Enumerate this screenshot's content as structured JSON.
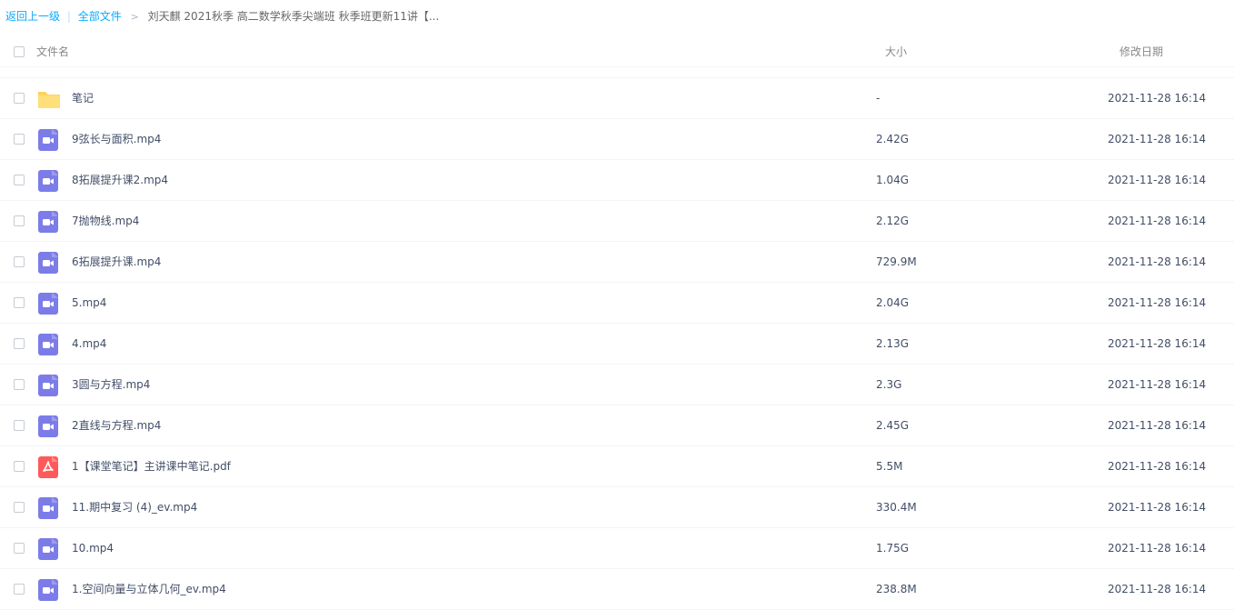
{
  "breadcrumb": {
    "back": "返回上一级",
    "separator": "|",
    "all_files": "全部文件",
    "arrow": ">",
    "current": "刘天麒 2021秋季 高二数学秋季尖端班 秋季班更新11讲【..."
  },
  "table": {
    "headers": {
      "name": "文件名",
      "size": "大小",
      "date": "修改日期"
    },
    "rows": [
      {
        "type": "folder",
        "icon": "folder-icon",
        "name": "笔记",
        "size": "-",
        "date": "2021-11-28 16:14"
      },
      {
        "type": "video",
        "icon": "video-file-icon",
        "name": "9弦长与面积.mp4",
        "size": "2.42G",
        "date": "2021-11-28 16:14"
      },
      {
        "type": "video",
        "icon": "video-file-icon",
        "name": "8拓展提升课2.mp4",
        "size": "1.04G",
        "date": "2021-11-28 16:14"
      },
      {
        "type": "video",
        "icon": "video-file-icon",
        "name": "7抛物线.mp4",
        "size": "2.12G",
        "date": "2021-11-28 16:14"
      },
      {
        "type": "video",
        "icon": "video-file-icon",
        "name": "6拓展提升课.mp4",
        "size": "729.9M",
        "date": "2021-11-28 16:14"
      },
      {
        "type": "video",
        "icon": "video-file-icon",
        "name": "5.mp4",
        "size": "2.04G",
        "date": "2021-11-28 16:14"
      },
      {
        "type": "video",
        "icon": "video-file-icon",
        "name": "4.mp4",
        "size": "2.13G",
        "date": "2021-11-28 16:14"
      },
      {
        "type": "video",
        "icon": "video-file-icon",
        "name": "3圆与方程.mp4",
        "size": "2.3G",
        "date": "2021-11-28 16:14"
      },
      {
        "type": "video",
        "icon": "video-file-icon",
        "name": "2直线与方程.mp4",
        "size": "2.45G",
        "date": "2021-11-28 16:14"
      },
      {
        "type": "pdf",
        "icon": "pdf-file-icon",
        "name": "1【课堂笔记】主讲课中笔记.pdf",
        "size": "5.5M",
        "date": "2021-11-28 16:14"
      },
      {
        "type": "video",
        "icon": "video-file-icon",
        "name": "11.期中复习 (4)_ev.mp4",
        "size": "330.4M",
        "date": "2021-11-28 16:14"
      },
      {
        "type": "video",
        "icon": "video-file-icon",
        "name": "10.mp4",
        "size": "1.75G",
        "date": "2021-11-28 16:14"
      },
      {
        "type": "video",
        "icon": "video-file-icon",
        "name": "1.空间向量与立体几何_ev.mp4",
        "size": "238.8M",
        "date": "2021-11-28 16:14"
      }
    ]
  },
  "colors": {
    "link": "#09aaff",
    "text": "#424e67",
    "folder": "#ffd35b",
    "video": "#7c7ce8",
    "pdf": "#ff5a5a",
    "divider": "#f2f4f8"
  }
}
